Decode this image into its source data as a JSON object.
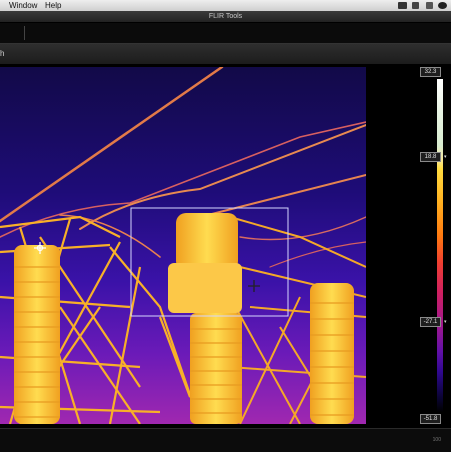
{
  "menubar": {
    "items": [
      "Window",
      "Help"
    ]
  },
  "window": {
    "title": "FLIR Tools"
  },
  "panel": {
    "title": "h"
  },
  "scale": {
    "max": "32.3",
    "upper": "18.8",
    "lower": "-27.1",
    "min": "-51.8"
  },
  "status": {
    "zoom": "100"
  },
  "colors": {
    "accent": "#ffd23a",
    "background": "#141414",
    "box": "#d6d6ff"
  },
  "icons": [
    "apple-icon",
    "display-icon",
    "volume-icon",
    "search-icon",
    "spot-marker-icon",
    "crosshair-icon"
  ]
}
